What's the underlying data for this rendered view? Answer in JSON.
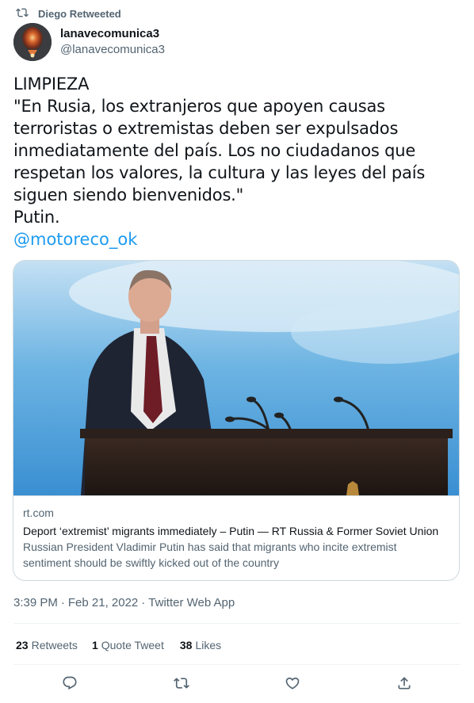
{
  "retweet_context": {
    "label": "Diego Retweeted",
    "icon": "retweet-icon"
  },
  "author": {
    "display_name": "lanavecomunica3",
    "handle": "@lanavecomunica3"
  },
  "tweet": {
    "text": "LIMPIEZA\n\"En Rusia, los extranjeros que apoyen causas terroristas o extremistas deben ser expulsados inmediatamente del país. Los no ciudadanos que respetan los valores, la cultura y las leyes del país siguen siendo bienvenidos.\"\nPutin.",
    "mention": "@motoreco_ok"
  },
  "card": {
    "domain": "rt.com",
    "title": "Deport ‘extremist’ migrants immediately – Putin — RT Russia & Former Soviet Union",
    "description": "Russian President Vladimir Putin has said that migrants who incite extremist sentiment should be swiftly kicked out of the country"
  },
  "timestamp": {
    "time": "3:39 PM",
    "separator": "·",
    "date": "Feb 21, 2022",
    "source": "Twitter Web App"
  },
  "stats": {
    "retweets_count": "23",
    "retweets_label": "Retweets",
    "quotes_count": "1",
    "quotes_label": "Quote Tweet",
    "likes_count": "38",
    "likes_label": "Likes"
  },
  "actions": {
    "reply_icon": "reply-icon",
    "retweet_icon": "retweet-icon",
    "like_icon": "heart-icon",
    "share_icon": "share-icon"
  },
  "colors": {
    "accent": "#1d9bf0",
    "text": "#0f1419",
    "muted": "#536471",
    "border": "#cfd9de"
  }
}
